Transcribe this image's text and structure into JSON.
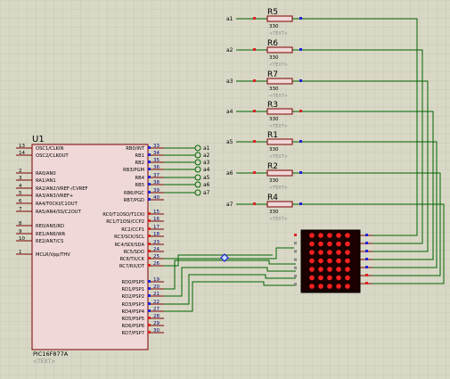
{
  "mcu": {
    "ref": "U1",
    "part": "PIC16F877A",
    "text_placeholder": "<TEXT>",
    "left_pins": [
      {
        "num": "13",
        "name": "OSC1/CLKIN"
      },
      {
        "num": "14",
        "name": "OSC2/CLKOUT"
      },
      {
        "num": "2",
        "name": "RA0/AN0"
      },
      {
        "num": "3",
        "name": "RA1/AN1"
      },
      {
        "num": "4",
        "name": "RA2/AN2/VREF-/CVREF"
      },
      {
        "num": "5",
        "name": "RA3/AN3/VREF+"
      },
      {
        "num": "6",
        "name": "RA4/T0CKI/C1OUT"
      },
      {
        "num": "7",
        "name": "RA5/AN4/SS/C2OUT"
      },
      {
        "num": "8",
        "name": "RE0/AN5/RD"
      },
      {
        "num": "9",
        "name": "RE1/AN6/WR"
      },
      {
        "num": "10",
        "name": "RE2/AN7/CS"
      },
      {
        "num": "1",
        "name": "MCLR/Vpp/THV"
      }
    ],
    "right_pins": [
      {
        "num": "33",
        "name": "RB0/INT"
      },
      {
        "num": "34",
        "name": "RB1"
      },
      {
        "num": "35",
        "name": "RB2"
      },
      {
        "num": "36",
        "name": "RB3/PGM"
      },
      {
        "num": "37",
        "name": "RB4"
      },
      {
        "num": "38",
        "name": "RB5"
      },
      {
        "num": "39",
        "name": "RB6/PGC"
      },
      {
        "num": "40",
        "name": "RB7/PGD"
      },
      {
        "num": "15",
        "name": "RC0/T1OSO/T1CKI"
      },
      {
        "num": "16",
        "name": "RC1/T1OSI/CCP2"
      },
      {
        "num": "17",
        "name": "RC2/CCP1"
      },
      {
        "num": "18",
        "name": "RC3/SCK/SCL"
      },
      {
        "num": "23",
        "name": "RC4/SDI/SDA"
      },
      {
        "num": "24",
        "name": "RC5/SDO"
      },
      {
        "num": "25",
        "name": "RC6/TX/CK"
      },
      {
        "num": "26",
        "name": "RC7/RX/DT"
      },
      {
        "num": "19",
        "name": "RD0/PSP0"
      },
      {
        "num": "20",
        "name": "RD1/PSP1"
      },
      {
        "num": "21",
        "name": "RD2/PSP2"
      },
      {
        "num": "22",
        "name": "RD3/PSP3"
      },
      {
        "num": "27",
        "name": "RD4/PSP4"
      },
      {
        "num": "28",
        "name": "RD5/PSP5"
      },
      {
        "num": "29",
        "name": "RD6/PSP6"
      },
      {
        "num": "30",
        "name": "RD7/PSP7"
      }
    ],
    "port_b_terminals": [
      "a1",
      "a2",
      "a3",
      "a4",
      "a5",
      "a6",
      "a7"
    ]
  },
  "resistors": [
    {
      "ref": "R5",
      "value": "330",
      "text": "<TEXT>",
      "net": "a1"
    },
    {
      "ref": "R6",
      "value": "330",
      "text": "<TEXT>",
      "net": "a2"
    },
    {
      "ref": "R7",
      "value": "330",
      "text": "<TEXT>",
      "net": "a3"
    },
    {
      "ref": "R3",
      "value": "330",
      "text": "<TEXT>",
      "net": "a4"
    },
    {
      "ref": "R1",
      "value": "330",
      "text": "<TEXT>",
      "net": "a5"
    },
    {
      "ref": "R2",
      "value": "330",
      "text": "<TEXT>",
      "net": "a6"
    },
    {
      "ref": "R4",
      "value": "330",
      "text": "<TEXT>",
      "net": "a7"
    }
  ],
  "matrix": {
    "rows": 7,
    "cols": 5,
    "led_color": "#ff2020",
    "body_color": "#1a0000"
  },
  "colors": {
    "background": "#d9d8c6",
    "grid": "#c6c5b2",
    "wire": "#006400",
    "body": "#f0d8d8",
    "outline": "#7a0000",
    "pin": "#7a0000",
    "pin_num": "#000080",
    "pin_blue": "#2222dd",
    "pin_red": "#dd2222",
    "label": "#000000",
    "placeholder": "#8a8a8a"
  }
}
